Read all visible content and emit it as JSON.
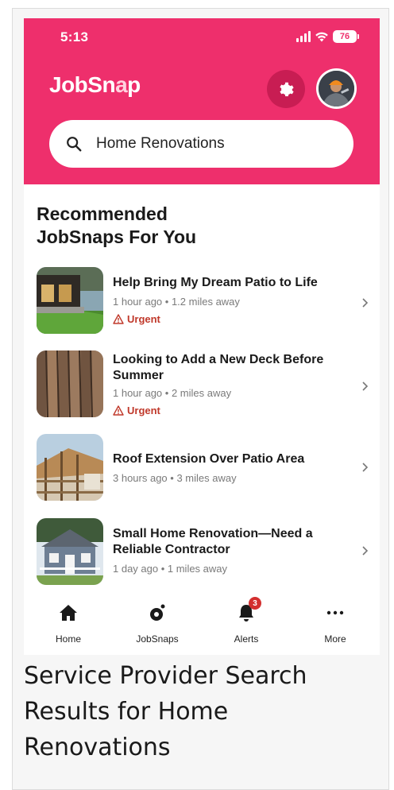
{
  "status_bar": {
    "time": "5:13",
    "battery": "76"
  },
  "header": {
    "logo_part1": "JobSn",
    "logo_part2": "a",
    "logo_part3": "p",
    "settings_icon": "gear-icon",
    "avatar_icon": "user-avatar"
  },
  "search": {
    "value": "Home Renovations",
    "placeholder": "Search"
  },
  "section": {
    "title_line1": "Recommended",
    "title_line2": "JobSnaps For You"
  },
  "items": [
    {
      "title": "Help Bring My Dream Patio to Life",
      "meta": "1 hour ago • 1.2 miles away",
      "urgent": "Urgent"
    },
    {
      "title": "Looking to Add a New Deck Before Summer",
      "meta": "1 hour ago • 2 miles away",
      "urgent": "Urgent"
    },
    {
      "title": "Roof Extension Over Patio Area",
      "meta": "3 hours ago • 3 miles away"
    },
    {
      "title": "Small Home Renovation—Need a Reliable Contractor",
      "meta": "1 day ago • 1 miles away"
    }
  ],
  "nav": [
    {
      "label": "Home",
      "icon": "home-icon"
    },
    {
      "label": "JobSnaps",
      "icon": "jobsnaps-icon"
    },
    {
      "label": "Alerts",
      "icon": "bell-icon",
      "badge": "3"
    },
    {
      "label": "More",
      "icon": "more-icon"
    }
  ],
  "colors": {
    "brand": "#ee2f6c",
    "brand_dark": "#c81d53",
    "urgent": "#c0392b"
  },
  "caption": "Service Provider Search Results for Home Renovations"
}
